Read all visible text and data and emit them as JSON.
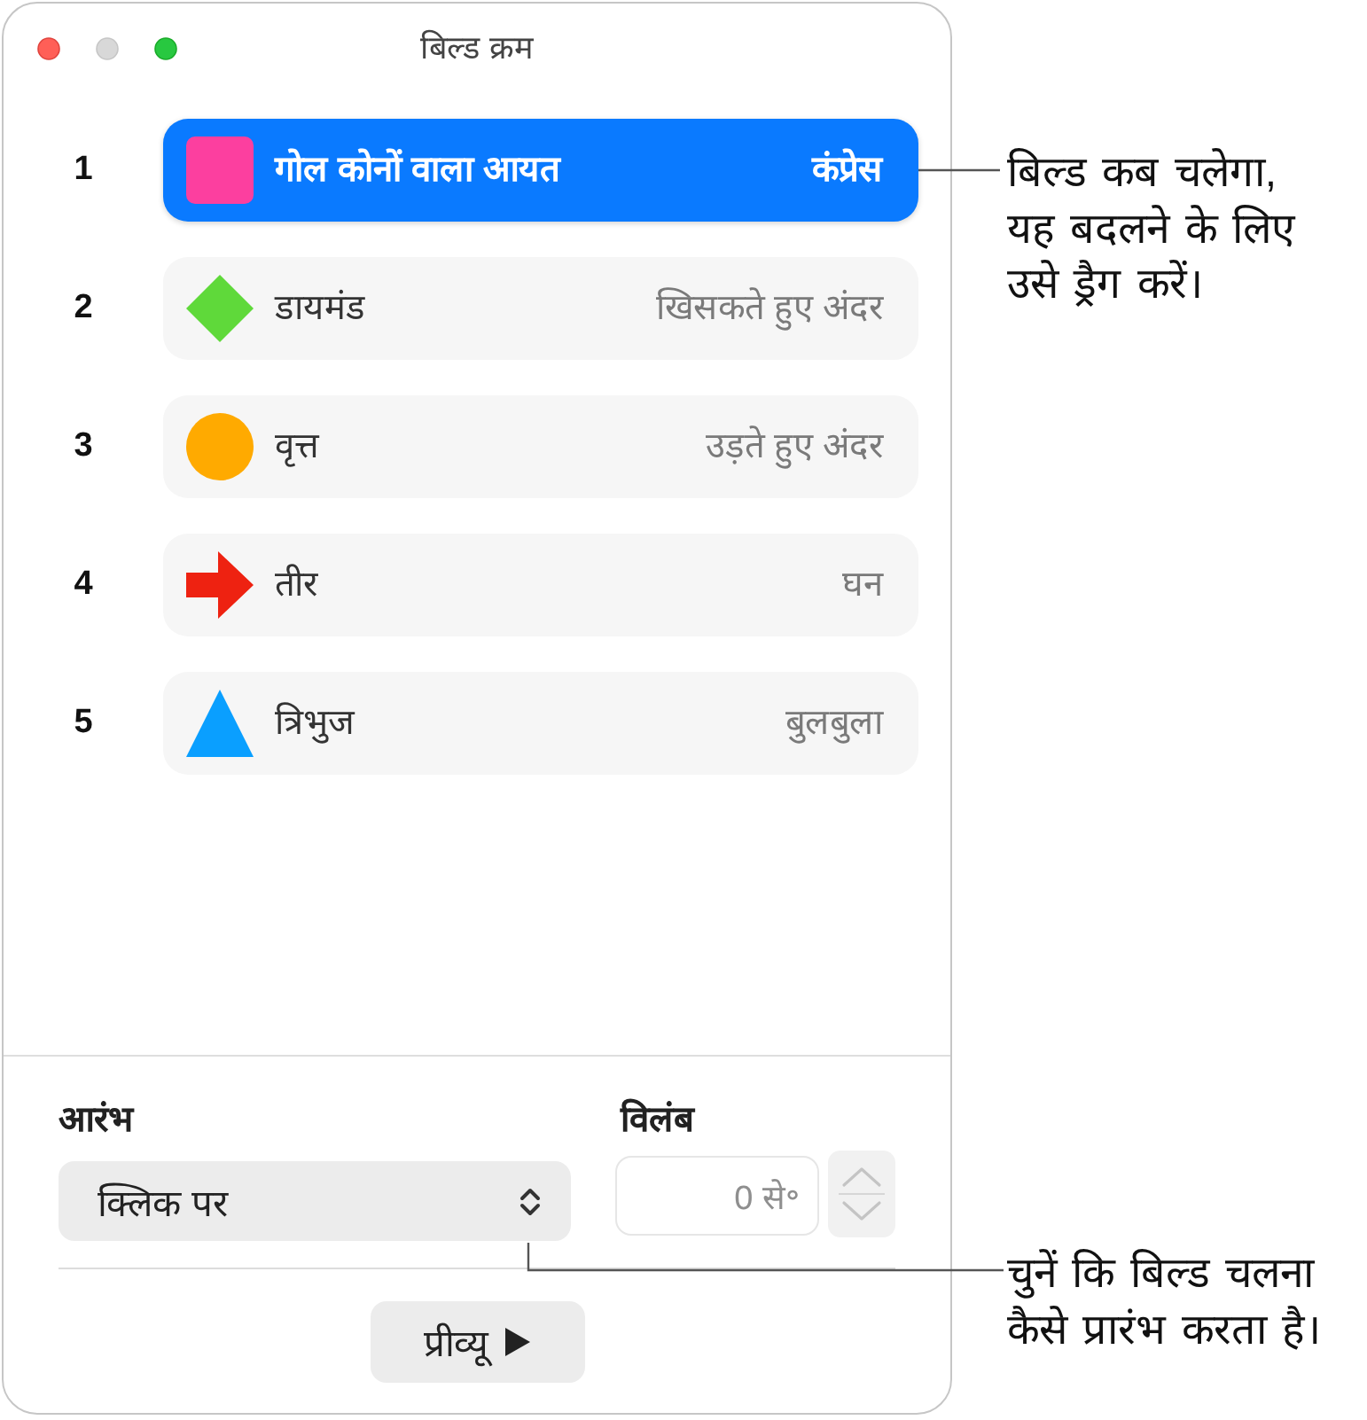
{
  "window": {
    "title": "बिल्ड क्रम",
    "controls": [
      {
        "kind": "close",
        "disabled": false
      },
      {
        "kind": "minimize",
        "disabled": true
      },
      {
        "kind": "zoom",
        "disabled": false
      }
    ]
  },
  "builds": [
    {
      "number": "1",
      "kind": "rounded-square",
      "color": "#fc3f9f",
      "name": "गोल कोनों वाला आयत",
      "effect": "कंप्रेस",
      "selected": true
    },
    {
      "number": "2",
      "kind": "diamond",
      "color": "#5fd93a",
      "name": "डायमंड",
      "effect": "खिसकते हुए अंदर",
      "selected": false
    },
    {
      "number": "3",
      "kind": "circle",
      "color": "#ffaa00",
      "name": "वृत्त",
      "effect": "उड़ते हुए अंदर",
      "selected": false
    },
    {
      "number": "4",
      "kind": "arrow",
      "color": "#ee2211",
      "name": "तीर",
      "effect": "घन",
      "selected": false
    },
    {
      "number": "5",
      "kind": "triangle",
      "color": "#0a9fff",
      "name": "त्रिभुज",
      "effect": "बुलबुला",
      "selected": false
    }
  ],
  "start": {
    "label": "आरंभ",
    "value": "क्लिक पर"
  },
  "delay": {
    "label": "विलंब",
    "value": "0 से॰",
    "disabled": true
  },
  "preview_button": {
    "label": "प्रीव्यू"
  },
  "callouts": [
    {
      "text": "बिल्ड कब चलेगा,\nयह बदलने के लिए\nउसे ड्रैग करें।"
    },
    {
      "text": "चुनें कि बिल्ड चलना\nकैसे प्रारंभ करता है।"
    }
  ]
}
